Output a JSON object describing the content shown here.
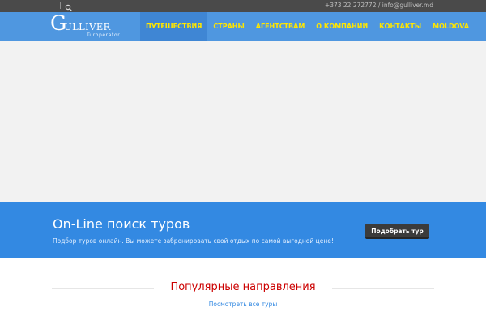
{
  "topbar": {
    "contact_text": "+373 22 272772 / info@gulliver.md",
    "search_icon": "search-icon"
  },
  "header": {
    "logo": {
      "initial": "G",
      "name_rest": "ULLIVER",
      "tagline": "Turoperator"
    },
    "menu": [
      {
        "label": "ПУТЕШЕСТВИЯ",
        "active": true
      },
      {
        "label": "СТРАНЫ",
        "active": false
      },
      {
        "label": "АГЕНТСТВАМ",
        "active": false
      },
      {
        "label": "О КОМПАНИИ",
        "active": false
      },
      {
        "label": "КОНТАКТЫ",
        "active": false
      },
      {
        "label": "MOLDOVA",
        "active": false
      }
    ]
  },
  "cta": {
    "title": "On-Line поиск туров",
    "description": "Подбор туров онлайн. Вы можете забронировать свой отдых по самой выгодной цене!",
    "button_label": "Подобрать тур"
  },
  "popular": {
    "heading": "Популярные направления",
    "view_all_link": "Посмотреть все туры"
  },
  "colors": {
    "topbar_bg": "#4a4a4a",
    "nav_bg": "#4f97e0",
    "menu_text": "#ffe600",
    "cta_bg": "#3389e2",
    "heading_red": "#cc0000"
  }
}
